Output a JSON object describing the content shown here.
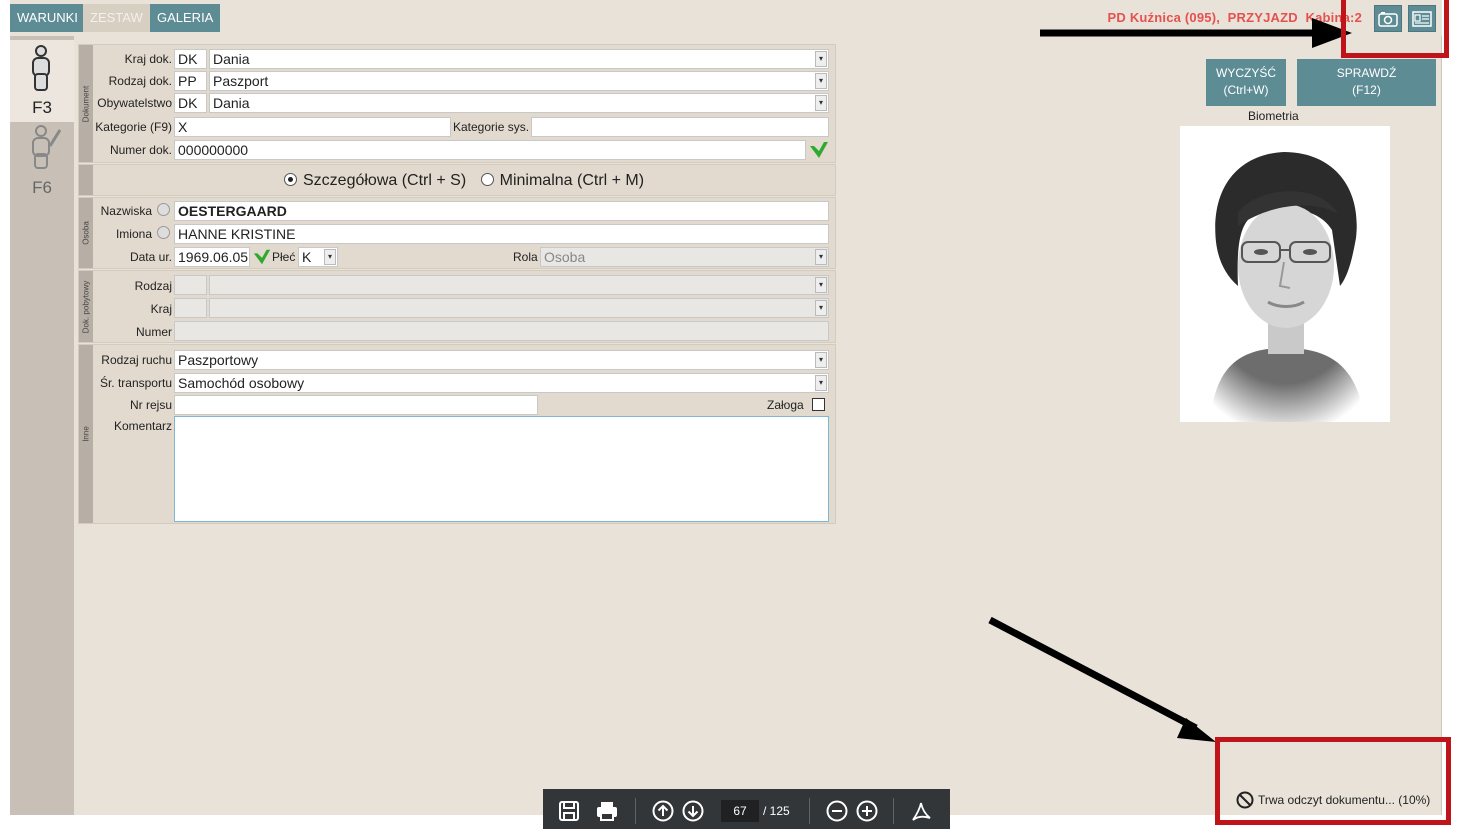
{
  "tabs": [
    "WARUNKI",
    "ZESTAW",
    "GALERIA"
  ],
  "top_status": "PD Kuźnica (095),  PRZYJAZD  Kabina:2",
  "left_nav": {
    "f3": "F3",
    "f6": "F6"
  },
  "document": {
    "section_label": "Dokument",
    "kraj_dok": {
      "label": "Kraj dok.",
      "code": "DK",
      "value": "Dania"
    },
    "rodzaj_dok": {
      "label": "Rodzaj dok.",
      "code": "PP",
      "value": "Paszport"
    },
    "obywatelstwo": {
      "label": "Obywatelstwo",
      "code": "DK",
      "value": "Dania"
    },
    "kategorie": {
      "label": "Kategorie (F9)",
      "value": "X"
    },
    "kategorie_sys": {
      "label": "Kategorie sys.",
      "value": ""
    },
    "numer_dok": {
      "label": "Numer dok.",
      "value": "000000000"
    }
  },
  "mode": {
    "detailed": "Szczegółowa (Ctrl + S)",
    "minimal": "Minimalna (Ctrl + M)",
    "selected": "detailed"
  },
  "person": {
    "section_label": "Osoba",
    "nazwiska": {
      "label": "Nazwiska",
      "value": "OESTERGAARD"
    },
    "imiona": {
      "label": "Imiona",
      "value": "HANNE KRISTINE"
    },
    "data_ur": {
      "label": "Data ur.",
      "value": "1969.06.05"
    },
    "plec": {
      "label": "Płeć",
      "value": "K"
    },
    "rola": {
      "label": "Rola",
      "value": "Osoba"
    }
  },
  "residence": {
    "section_label": "Dok. pobytowy",
    "rodzaj": {
      "label": "Rodzaj",
      "value": ""
    },
    "kraj": {
      "label": "Kraj",
      "value": ""
    },
    "numer": {
      "label": "Numer",
      "value": ""
    }
  },
  "other": {
    "section_label": "Inne",
    "rodzaj_ruchu": {
      "label": "Rodzaj ruchu",
      "value": "Paszportowy"
    },
    "sr_transportu": {
      "label": "Śr. transportu",
      "value": "Samochód osobowy"
    },
    "nr_rejsu": {
      "label": "Nr rejsu",
      "value": ""
    },
    "zaloga": {
      "label": "Załoga",
      "checked": false
    },
    "komentarz": {
      "label": "Komentarz",
      "value": ""
    }
  },
  "buttons": {
    "clear": "WYCZYŚĆ",
    "clear_key": "(Ctrl+W)",
    "check": "SPRAWDŹ",
    "check_key": "(F12)"
  },
  "biometrics_label": "Biometria",
  "reading_status": "Trwa odczyt dokumentu... (10%)",
  "pdf_toolbar": {
    "page": "67",
    "total": "/ 125"
  },
  "colors": {
    "accent": "#5e8c95",
    "status_red": "#e5514f",
    "annotation_red": "#c0141b",
    "background": "#e9e2d9"
  }
}
